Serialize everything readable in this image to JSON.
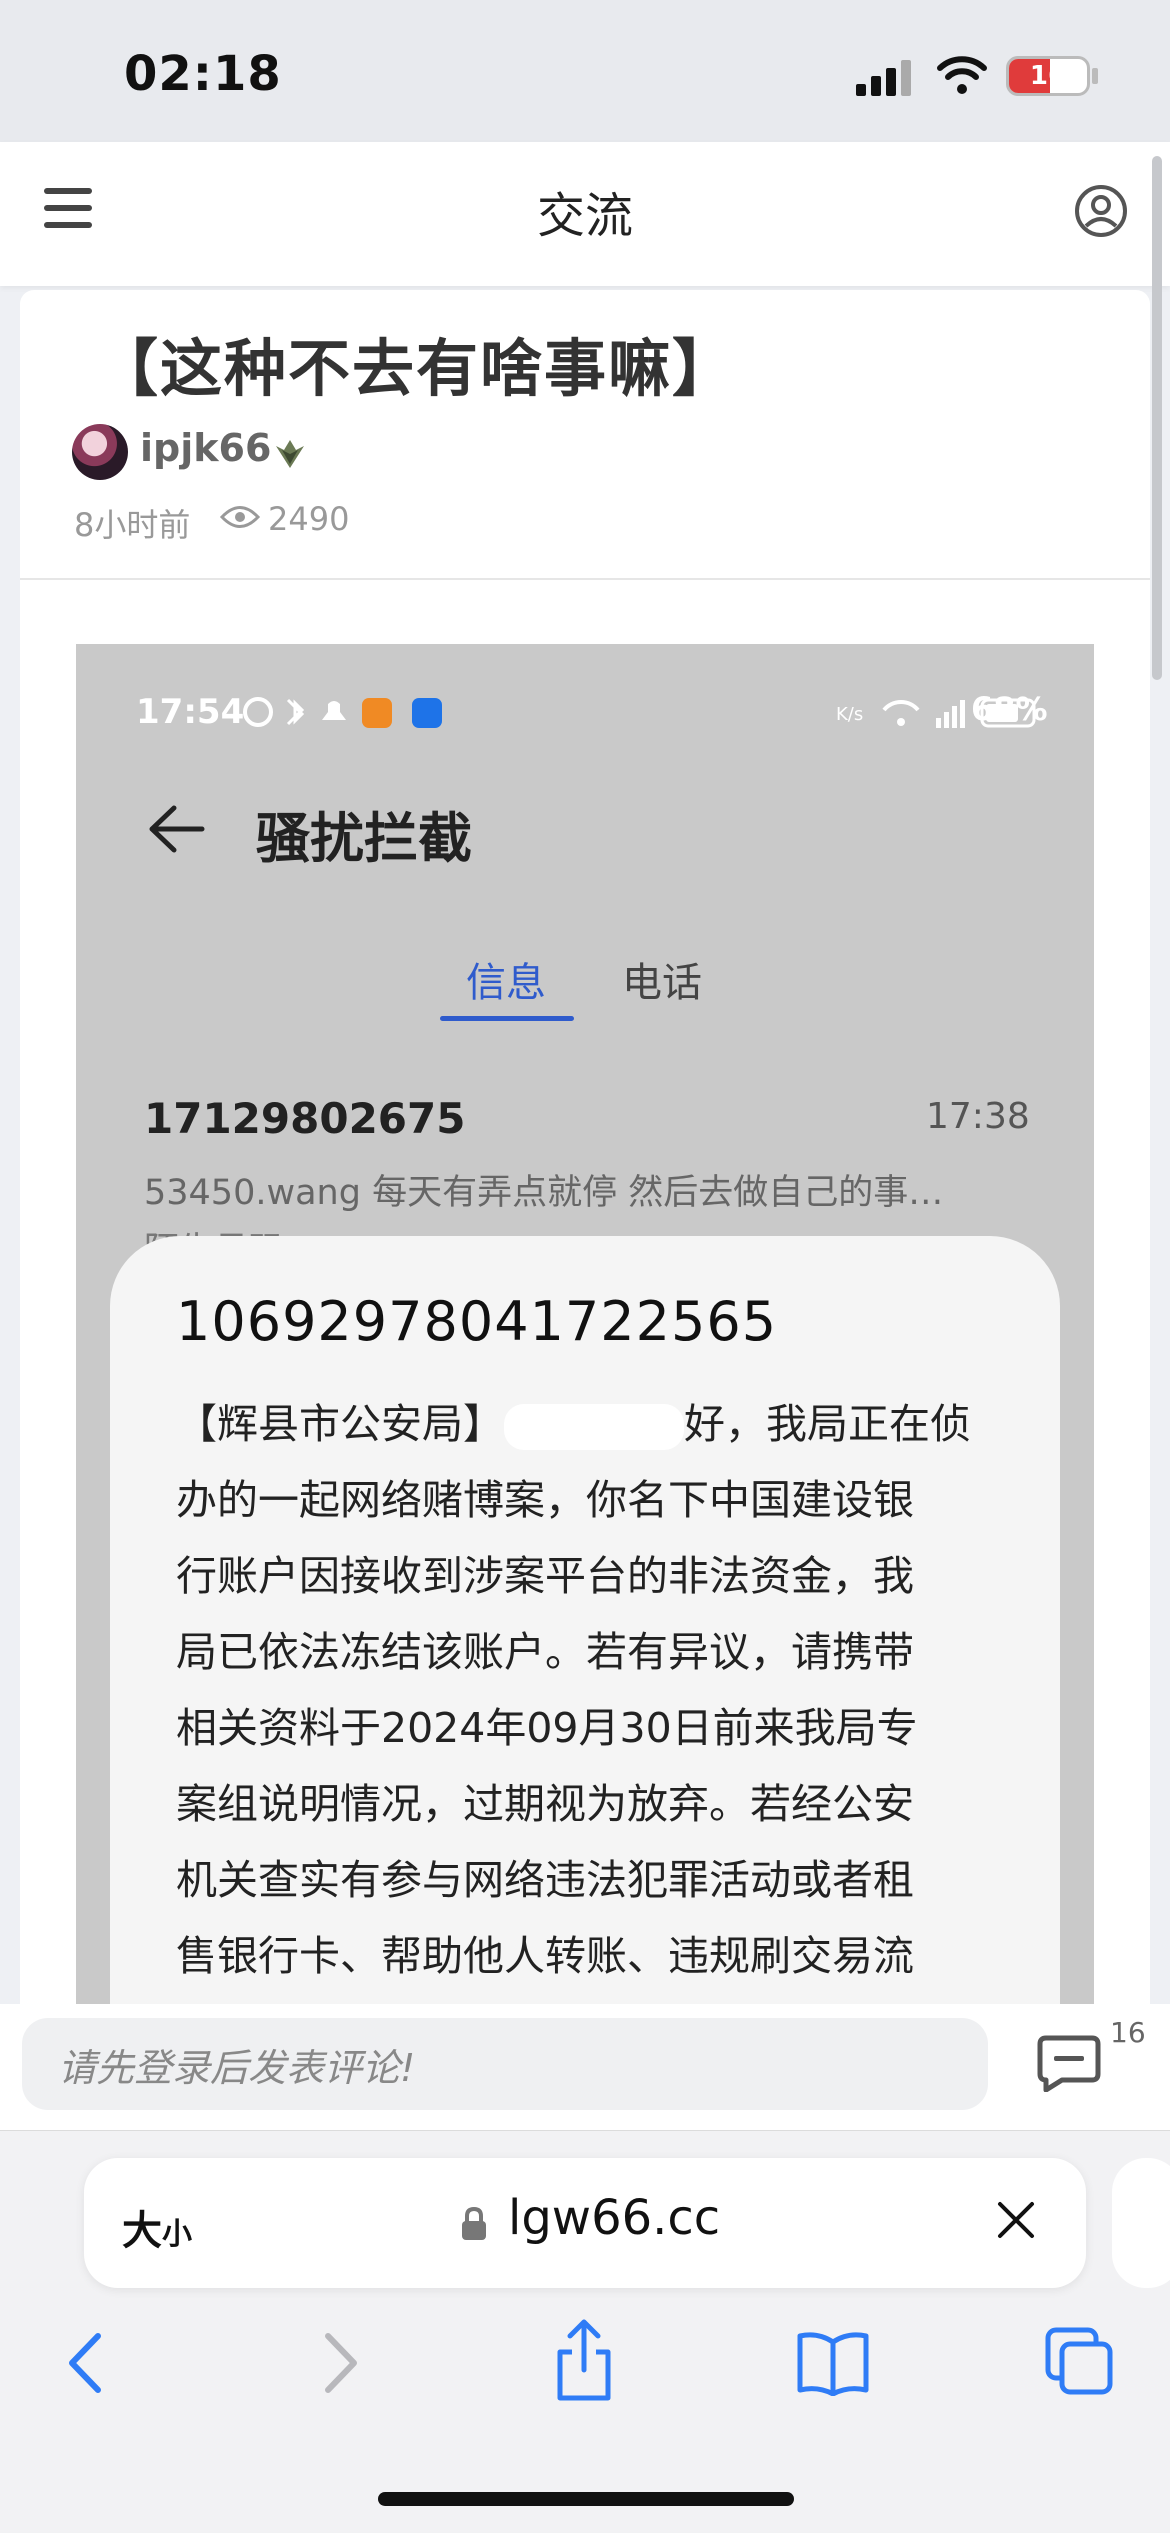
{
  "status_bar": {
    "time": "02:18",
    "battery": "16"
  },
  "header": {
    "title": "交流"
  },
  "post": {
    "title": "【这种不去有啥事嘛】",
    "author": "ipjk66",
    "time_ago": "8小时前",
    "views": "2490"
  },
  "screenshot": {
    "time": "17:54",
    "battery": "68%",
    "heading": "骚扰拦截",
    "tabs": [
      "信息",
      "电话"
    ],
    "message": {
      "sender": "17129802675",
      "time": "17:38",
      "preview": "53450.wang 每天有弄点就停 然后去做自己的事…",
      "preview_line2": "陌生号码"
    },
    "popup": {
      "number": "10692978041722565",
      "line1_start": "【辉县市公安局】",
      "line1_end": "好，我局正在侦",
      "lines": [
        "办的一起网络赌博案，你名下中国建设银",
        "行账户因接收到涉案平台的非法资金，我",
        "局已依法冻结该账户。若有异议，请携带",
        "相关资料于2024年09月30日前来我局专",
        "案组说明情况，过期视为放弃。若经公安",
        "机关查实有参与网络违法犯罪活动或者租",
        "售银行卡、帮助他人转账、违规刷交易流"
      ]
    }
  },
  "comment": {
    "placeholder": "请先登录后发表评论!",
    "count": "16"
  },
  "browser": {
    "text_size_label": "大",
    "text_size_small": "小",
    "domain": "lgw66.cc"
  }
}
